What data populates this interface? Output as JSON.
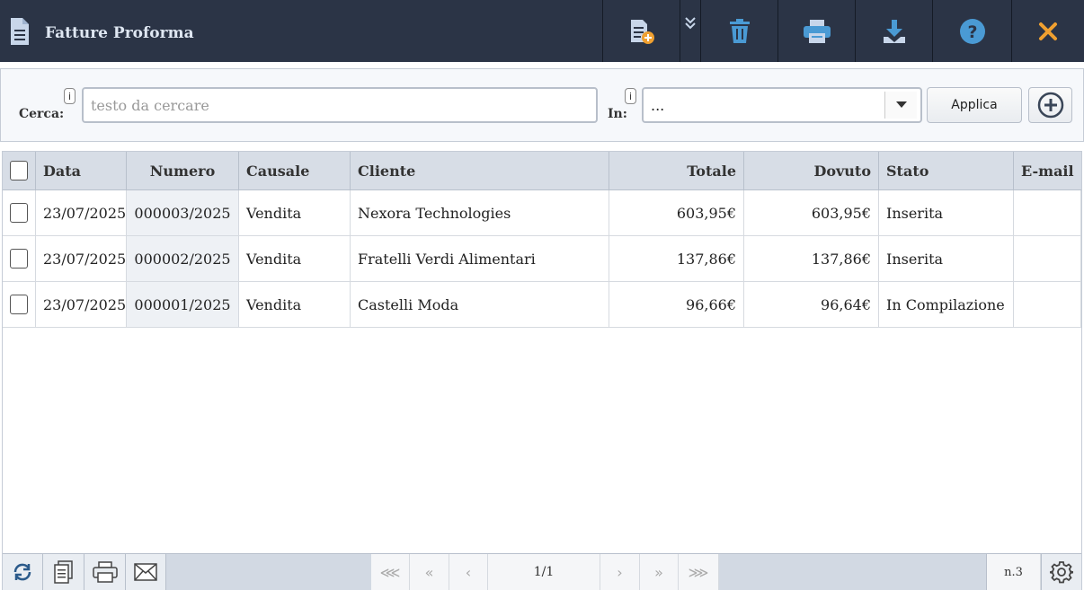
{
  "header": {
    "title": "Fatture Proforma",
    "bg_color": "#2b3446",
    "icons": [
      "document-icon",
      "new-document-icon",
      "double-chevron-down-icon",
      "trash-icon",
      "printer-icon",
      "download-icon",
      "help-icon",
      "close-icon"
    ],
    "accent_colors": {
      "blue": "#4a9ad4",
      "close": "#f0a030"
    }
  },
  "search": {
    "label": "Cerca:",
    "info": "i",
    "placeholder": "testo da cercare",
    "value": "",
    "in_label": "In:",
    "in_value": "...",
    "apply_label": "Applica"
  },
  "table": {
    "columns": [
      "Data",
      "Numero",
      "Causale",
      "Cliente",
      "Totale",
      "Dovuto",
      "Stato",
      "E-mail"
    ],
    "rows": [
      {
        "data": "23/07/2025",
        "numero": "000003/2025",
        "causale": "Vendita",
        "cliente": "Nexora Technologies",
        "totale": "603,95€",
        "dovuto": "603,95€",
        "stato": "Inserita",
        "email": ""
      },
      {
        "data": "23/07/2025",
        "numero": "000002/2025",
        "causale": "Vendita",
        "cliente": "Fratelli Verdi Alimentari",
        "totale": "137,86€",
        "dovuto": "137,86€",
        "stato": "Inserita",
        "email": ""
      },
      {
        "data": "23/07/2025",
        "numero": "000001/2025",
        "causale": "Vendita",
        "cliente": "Castelli Moda",
        "totale": "96,66€",
        "dovuto": "96,64€",
        "stato": "In Compilazione",
        "email": ""
      }
    ]
  },
  "footer": {
    "first": "⋘",
    "prev_fast": "«",
    "prev": "‹",
    "page": "1/1",
    "next": "›",
    "next_fast": "»",
    "last": "⋙",
    "count": "n.3"
  }
}
